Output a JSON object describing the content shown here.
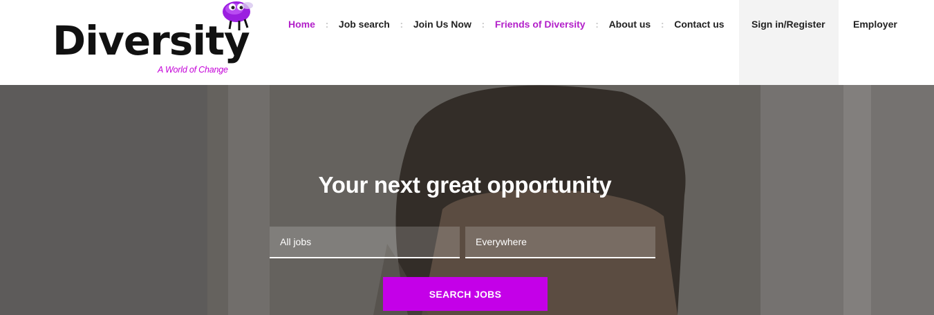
{
  "brand": {
    "name": "Diversity",
    "tagline": "A World of Change",
    "accent_color": "#c400e8",
    "logo_icon": "purple-bee-icon"
  },
  "nav": {
    "items": [
      {
        "label": "Home",
        "active": true
      },
      {
        "label": "Job search",
        "active": false
      },
      {
        "label": "Join Us Now",
        "active": false
      },
      {
        "label": "Friends of Diversity",
        "active": true
      },
      {
        "label": "About us",
        "active": false
      },
      {
        "label": "Contact us",
        "active": false
      }
    ],
    "separator": ":",
    "signin_label": "Sign in/Register",
    "employer_label": "Employer"
  },
  "hero": {
    "title": "Your next great opportunity",
    "keywords_placeholder": "All jobs",
    "location_placeholder": "Everywhere",
    "search_button": "SEARCH JOBS"
  }
}
